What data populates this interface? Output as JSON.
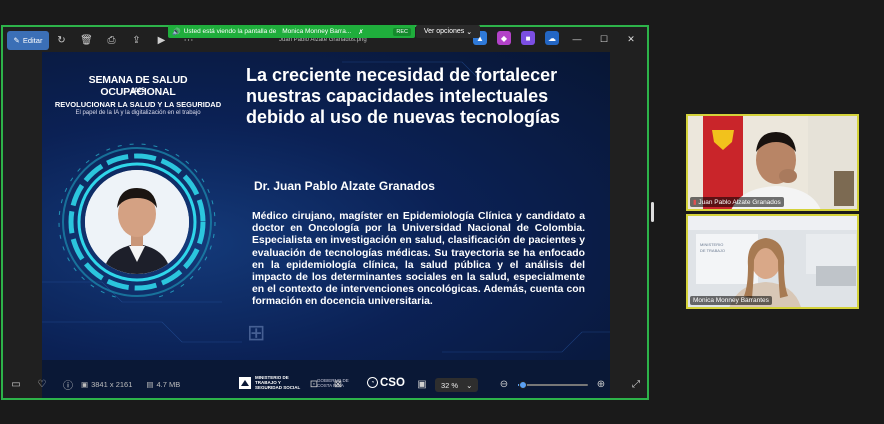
{
  "meeting": {
    "share_banner": "Usted está viendo la pantalla de",
    "presenter": "Monica Monney Barra...",
    "rec_label": "REC",
    "view_options": "Ver opciones"
  },
  "viewer": {
    "edit_label": "Editar",
    "filename": "Juan Pablo Alzate Granados.png",
    "dimensions": "3841 x 2161",
    "file_size": "4.7 MB",
    "zoom": "32 %",
    "zoom_fraction": 0.07
  },
  "slide": {
    "event_title": "SEMANA DE SALUD OCUPACIONAL",
    "event_year": "2025",
    "event_subtitle": "REVOLUCIONAR LA SALUD Y LA SEGURIDAD",
    "event_tagline": "El papel de la IA y la digitalización en el trabajo",
    "headline": "La creciente necesidad de fortalecer nuestras capacidades intelectuales debido al uso de nuevas tecnologías",
    "speaker_name": "Dr. Juan Pablo Alzate Granados",
    "bio": "Médico cirujano, magíster en Epidemiología Clínica y candidato a doctor en Oncología por la Universidad Nacional de Colombia. Especialista en investigación en salud, clasificación de pacientes y evaluación de tecnologías médicas. Su trayectoria se ha enfocado en la epidemiología clínica, la salud pública y el análisis del impacto de los determinantes sociales en la salud, especialmente en el contexto de intervenciones oncológicas. Además, cuenta con formación en docencia universitaria.",
    "footer_ministry": "MINISTERIO DE TRABAJO Y SEGURIDAD SOCIAL",
    "footer_gov": "GOBIERNO DE COSTA RICA",
    "footer_cso": "CSO"
  },
  "participants": [
    {
      "name": "Juan Pablo Alzate Granados"
    },
    {
      "name": "Monica Monney Barrantes"
    }
  ],
  "colors": {
    "share_green": "#1fae3c",
    "slide_navy": "#0b1d46",
    "ring_cyan": "#2fd6ea",
    "tile_border": "#d4d23a",
    "accent_blue": "#3b6fb6"
  }
}
